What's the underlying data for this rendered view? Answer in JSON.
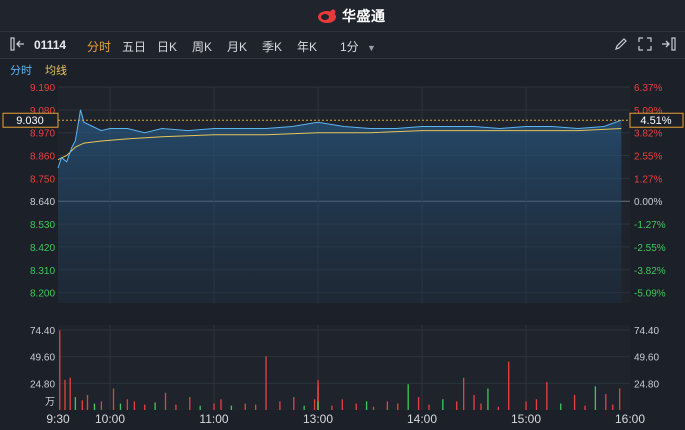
{
  "app": {
    "name": "华盛通"
  },
  "toolbar": {
    "stock_code": "01114",
    "tabs": [
      "分时",
      "五日",
      "日K",
      "周K",
      "月K",
      "季K",
      "年K"
    ],
    "active_tab": "分时",
    "interval": "1分"
  },
  "subbar": {
    "label_time": "分时",
    "label_avg": "均线"
  },
  "colors": {
    "price": "#5ab4f0",
    "avg": "#e8c45a",
    "up": "#e84040",
    "down": "#3cc85a",
    "neutral": "#c8ccd4",
    "accent": "#e8a23a"
  },
  "chart_data": [
    {
      "type": "line",
      "title": "",
      "prev_close": 8.64,
      "current_price": "9.030",
      "current_pct": "4.51%",
      "price_ticks": [
        "9.190",
        "9.080",
        "8.970",
        "8.860",
        "8.750",
        "8.640",
        "8.530",
        "8.420",
        "8.310",
        "8.200"
      ],
      "pct_ticks": [
        "6.37%",
        "5.09%",
        "3.82%",
        "2.55%",
        "1.27%",
        "0.00%",
        "-1.27%",
        "-2.55%",
        "-3.82%",
        "-5.09%"
      ],
      "ylim": [
        8.15,
        9.19
      ],
      "x_ticks": [
        "9:30",
        "10:00",
        "11:00",
        "13:00",
        "14:00",
        "15:00",
        "16:00"
      ],
      "series": [
        {
          "name": "分时",
          "x": [
            "9:30",
            "9:32",
            "9:35",
            "9:38",
            "9:40",
            "9:43",
            "9:45",
            "9:50",
            "9:55",
            "10:00",
            "10:10",
            "10:20",
            "10:30",
            "10:45",
            "11:00",
            "11:15",
            "11:30",
            "11:45",
            "12:00",
            "13:15",
            "13:30",
            "13:45",
            "14:00",
            "14:15",
            "14:30",
            "14:45",
            "15:00",
            "15:15",
            "15:30",
            "15:45",
            "15:55"
          ],
          "values": [
            8.8,
            8.85,
            8.83,
            8.9,
            8.93,
            9.08,
            9.02,
            9.0,
            8.98,
            8.99,
            8.99,
            8.97,
            8.99,
            8.98,
            8.99,
            8.99,
            8.99,
            9.0,
            9.02,
            9.0,
            8.99,
            8.99,
            9.0,
            9.0,
            9.0,
            8.99,
            9.0,
            9.0,
            8.99,
            9.0,
            9.03
          ]
        },
        {
          "name": "均线",
          "x": [
            "9:30",
            "9:35",
            "9:40",
            "9:45",
            "9:55",
            "10:10",
            "10:30",
            "11:00",
            "11:30",
            "12:00",
            "13:30",
            "14:00",
            "14:30",
            "15:00",
            "15:30",
            "15:55"
          ],
          "values": [
            8.84,
            8.86,
            8.9,
            8.92,
            8.93,
            8.94,
            8.95,
            8.96,
            8.96,
            8.97,
            8.97,
            8.98,
            8.98,
            8.98,
            8.98,
            8.99
          ]
        }
      ]
    },
    {
      "type": "bar",
      "title": "",
      "ylabel": "万",
      "y_ticks": [
        "74.40",
        "49.60",
        "24.80"
      ],
      "ylim": [
        0,
        74.4
      ],
      "series": [
        {
          "name": "成交量",
          "x": [
            "9:31",
            "9:34",
            "9:37",
            "9:40",
            "9:44",
            "9:47",
            "9:51",
            "9:55",
            "10:02",
            "10:06",
            "10:10",
            "10:14",
            "10:20",
            "10:26",
            "10:32",
            "10:38",
            "10:46",
            "10:52",
            "11:00",
            "11:04",
            "11:10",
            "11:18",
            "11:24",
            "11:30",
            "11:38",
            "11:46",
            "11:52",
            "11:58",
            "12:02",
            "12:06",
            "12:12",
            "12:20",
            "12:28",
            "12:34",
            "12:40",
            "12:48",
            "12:56",
            "13:08",
            "13:14",
            "13:22",
            "13:28",
            "13:32",
            "13:40",
            "13:46",
            "13:52",
            "13:58",
            "14:04",
            "14:12",
            "14:20",
            "14:24",
            "14:30",
            "14:34",
            "14:38",
            "14:44",
            "14:50",
            "15:00",
            "15:06",
            "15:12",
            "15:20",
            "15:28",
            "15:34",
            "15:40",
            "15:46",
            "15:50",
            "15:54"
          ],
          "values": [
            74,
            28,
            30,
            12,
            9,
            14,
            6,
            8,
            20,
            6,
            10,
            8,
            5,
            7,
            16,
            5,
            12,
            4,
            6,
            10,
            4,
            6,
            5,
            50,
            8,
            12,
            4,
            10,
            22,
            5,
            14,
            6,
            28,
            5,
            10,
            25,
            8,
            4,
            10,
            6,
            8,
            3,
            8,
            6,
            24,
            12,
            5,
            10,
            8,
            30,
            14,
            6,
            20,
            3,
            45,
            8,
            10,
            26,
            6,
            14,
            4,
            22,
            15,
            5,
            20
          ],
          "colors": [
            "up",
            "up",
            "up",
            "down",
            "up",
            "up",
            "down",
            "up",
            "up",
            "down",
            "up",
            "up",
            "up",
            "down",
            "up",
            "up",
            "up",
            "down",
            "up",
            "up",
            "down",
            "up",
            "up",
            "up",
            "up",
            "up",
            "down",
            "up",
            "down",
            "up",
            "up",
            "down",
            "up",
            "up",
            "up",
            "up",
            "down",
            "up",
            "up",
            "up",
            "down",
            "up",
            "up",
            "up",
            "down",
            "up",
            "up",
            "down",
            "up",
            "up",
            "up",
            "up",
            "down",
            "up",
            "up",
            "up",
            "up",
            "up",
            "down",
            "up",
            "up",
            "down",
            "up",
            "up",
            "up"
          ]
        }
      ]
    }
  ]
}
